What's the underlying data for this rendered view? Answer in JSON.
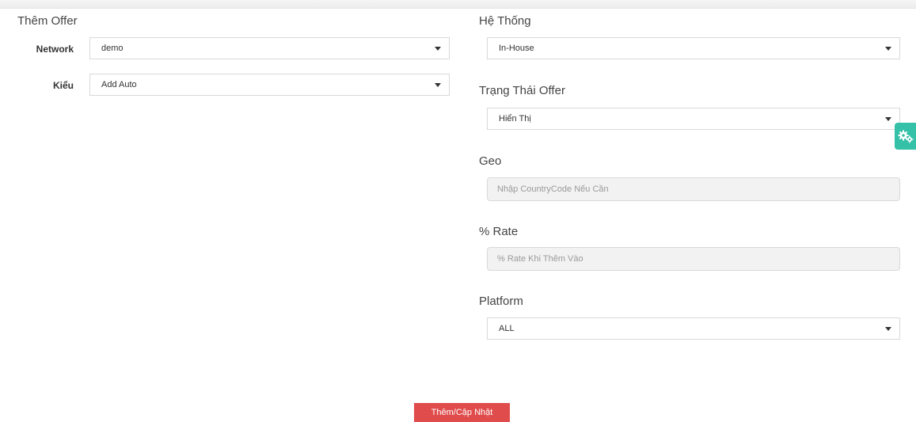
{
  "left": {
    "title": "Thêm Offer",
    "network": {
      "label": "Network",
      "value": "demo"
    },
    "type": {
      "label": "Kiểu",
      "value": "Add Auto"
    }
  },
  "right": {
    "system": {
      "label": "Hệ Thống",
      "value": "In-House"
    },
    "status": {
      "label": "Trạng Thái Offer",
      "value": "Hiển Thị"
    },
    "geo": {
      "label": "Geo",
      "placeholder": "Nhập CountryCode Nếu Cần"
    },
    "rate": {
      "label": "% Rate",
      "placeholder": "% Rate Khi Thêm Vào"
    },
    "platform": {
      "label": "Platform",
      "value": "ALL"
    }
  },
  "submit_label": "Thêm/Cập Nhật",
  "colors": {
    "accent_red": "#e04c4c",
    "settings_teal": "#35c1a8"
  },
  "icons": {
    "settings_tab": "gear-icon",
    "dropdown": "chevron-down-icon"
  }
}
